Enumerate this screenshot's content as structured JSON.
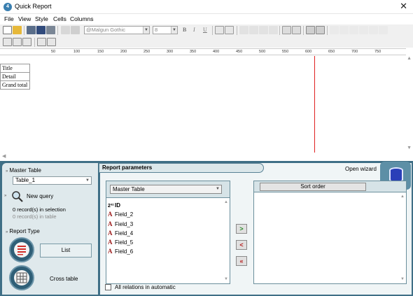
{
  "app": {
    "title": "Quick Report",
    "icon": "app-icon",
    "close": "✕"
  },
  "menu": [
    "File",
    "View",
    "Style",
    "Cells",
    "Columns"
  ],
  "toolbar": {
    "font_name": "@Malgun Gothic",
    "font_size": "8",
    "bold": "B",
    "italic": "I",
    "underline": "U"
  },
  "ruler": [
    "50",
    "100",
    "150",
    "200",
    "250",
    "300",
    "350",
    "400",
    "450",
    "500",
    "550",
    "600",
    "650",
    "700",
    "750"
  ],
  "sections": [
    "Title",
    "Detail",
    "Grand total"
  ],
  "left_panel": {
    "master_table_label": "Master Table",
    "master_table_value": "Table_1",
    "new_query": "New query",
    "records_selection": "0 record(s) in selection",
    "records_table": "0 record(s) in table",
    "report_type_label": "Report Type",
    "list_label": "List",
    "cross_table_label": "Cross table"
  },
  "params": {
    "title": "Report parameters",
    "open_wizard": "Open wizard",
    "master_select": "Master Table",
    "sort_order": "Sort order",
    "key_field": {
      "prefix": "2³²",
      "name": "ID"
    },
    "fields": [
      "Field_2",
      "Field_3",
      "Field_4",
      "Field_5",
      "Field_6"
    ],
    "add_arrow": ">",
    "remove_arrow": "<",
    "remove_all_arrow": "«",
    "all_relations": "All relations in automatic"
  },
  "colors": {
    "panel_bg": "#3f6f86",
    "accent_red": "#e02020"
  }
}
